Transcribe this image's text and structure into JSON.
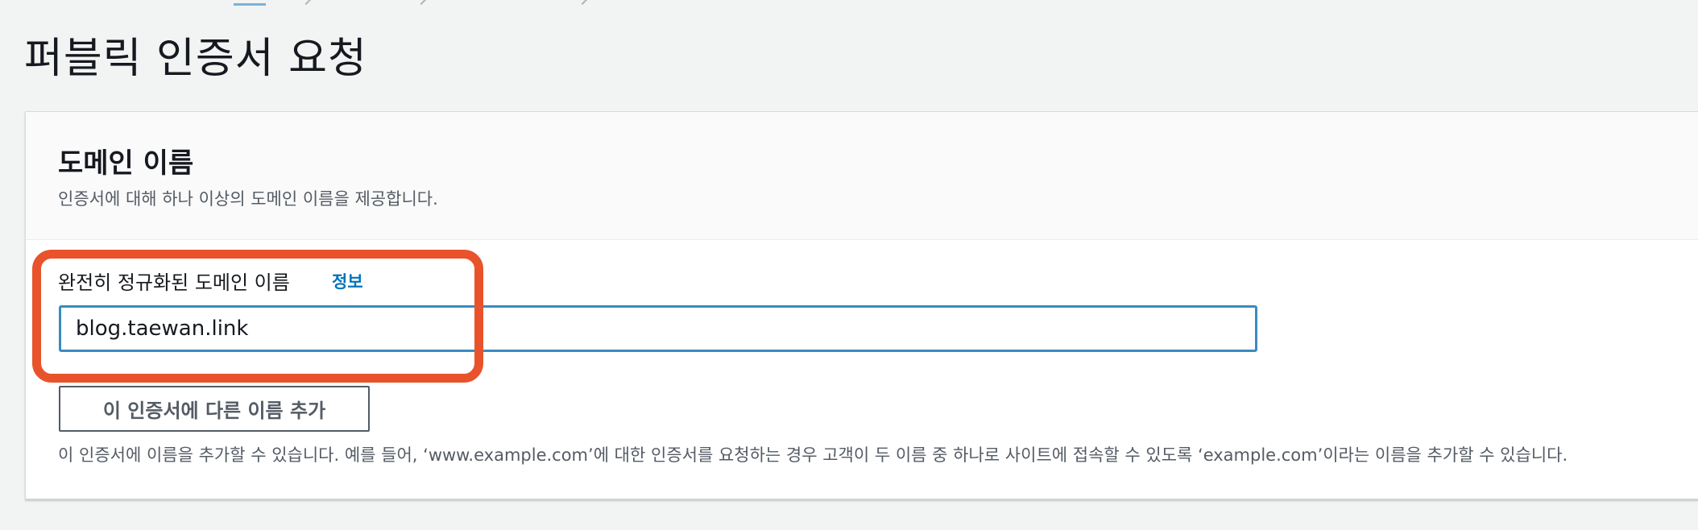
{
  "page": {
    "title": "퍼블릭 인증서 요청"
  },
  "domain_section": {
    "title": "도메인 이름",
    "description": "인증서에 대해 하나 이상의 도메인 이름을 제공합니다.",
    "field": {
      "label": "완전히 정규화된 도메인 이름",
      "info_link": "정보",
      "value": "blog.taewan.link"
    },
    "add_button_label": "이 인증서에 다른 이름 추가",
    "help_text": "이 인증서에 이름을 추가할 수 있습니다. 예를 들어, ‘www.example.com’에 대한 인증서를 요청하는 경우 고객이 두 이름 중 하나로 사이트에 접속할 수 있도록 ‘example.com’이라는 이름을 추가할 수 있습니다."
  },
  "colors": {
    "background": "#f2f3f3",
    "panel": "#ffffff",
    "link": "#0073bb",
    "input_focus_border": "#3a8bc0",
    "annotation_highlight": "#e8532c"
  }
}
